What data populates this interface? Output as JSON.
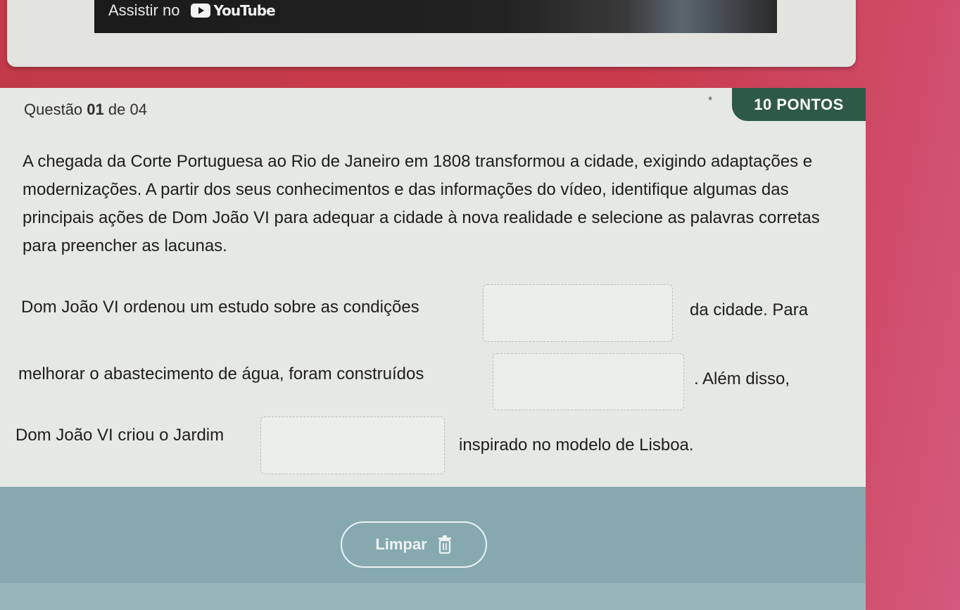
{
  "video": {
    "watch_on": "Assistir no",
    "youtube": "YouTube"
  },
  "question": {
    "counter_prefix": "Questão",
    "number": "01",
    "counter_suffix": "de 04",
    "required_mark": "*",
    "points": "10 PONTOS",
    "statement": "A chegada da Corte Portuguesa ao Rio de Janeiro em 1808 transformou a cidade, exigindo adaptações e modernizações. A partir dos seus conhecimentos e das informações do vídeo, identifique algumas das principais ações de Dom João VI para adequar a cidade à nova realidade e selecione as palavras corretas para preencher as lacunas."
  },
  "fill": {
    "line1_before": "Dom João VI ordenou um estudo sobre as condições",
    "line1_after": "da cidade. Para",
    "line2_before": "melhorar o abastecimento de água, foram construídos",
    "line2_after": ". Além disso,",
    "line3_before": "Dom João VI criou o Jardim",
    "line3_after": "inspirado no modelo de Lisboa.",
    "blanks": [
      "",
      "",
      ""
    ]
  },
  "actions": {
    "clear_label": "Limpar"
  }
}
